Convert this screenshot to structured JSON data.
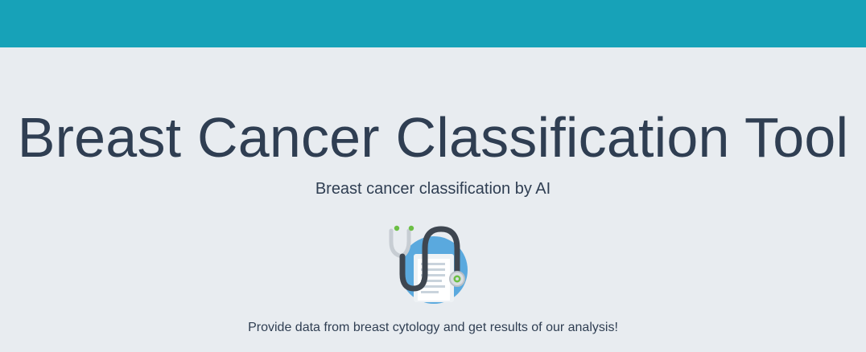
{
  "header": {
    "bar_color": "#17a2b8"
  },
  "hero": {
    "title": "Breast Cancer Classification Tool",
    "subtitle": "Breast cancer classification by AI",
    "tagline": "Provide data from breast cytology and get results of our analysis!",
    "illustration_icon": "stethoscope-clipboard-icon"
  }
}
